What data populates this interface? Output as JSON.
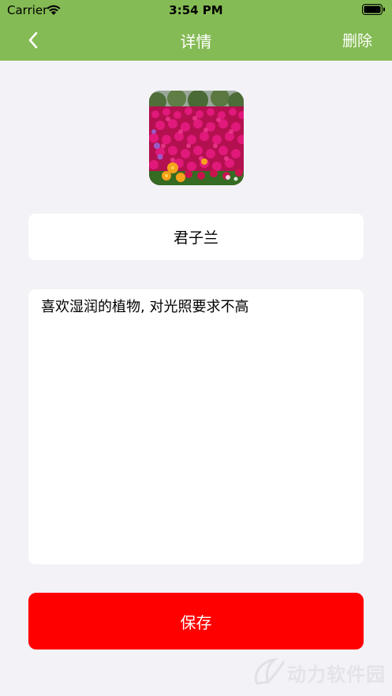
{
  "status_bar": {
    "carrier": "Carrier",
    "time": "3:54 PM",
    "icons": [
      "wifi-icon",
      "battery-icon"
    ]
  },
  "nav": {
    "back_icon": "chevron-left-icon",
    "title": "详情",
    "delete_label": "删除"
  },
  "plant": {
    "photo_icon": "flower-photo",
    "name": "君子兰",
    "description": "喜欢湿润的植物, 对光照要求不高"
  },
  "actions": {
    "save_label": "保存"
  },
  "watermark": {
    "text": "动力软件园"
  },
  "colors": {
    "header": "#85bb55",
    "background": "#f3f2f7",
    "save_button": "#fe0000",
    "field": "#ffffff"
  }
}
